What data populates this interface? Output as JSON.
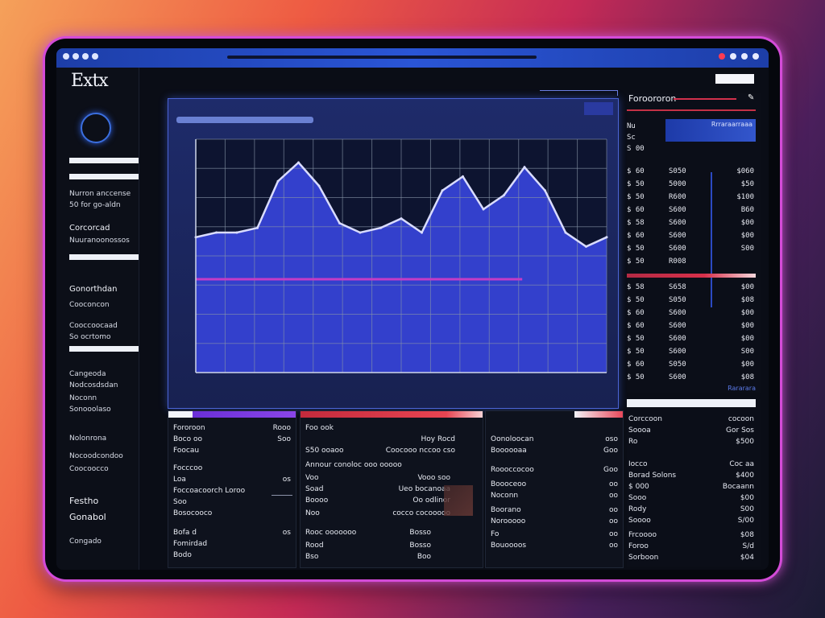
{
  "app": {
    "logo_text": "Extx"
  },
  "sidebar": {
    "items": [
      {
        "label": "Nurron anccense"
      },
      {
        "label": "50 for go-aldn"
      },
      {
        "label": "Corcorcad"
      },
      {
        "label": "Nuuranoonossos"
      },
      {
        "label": "Gonorthdan"
      },
      {
        "label": "Cooconcon"
      },
      {
        "label": "Cooccoocaad"
      },
      {
        "label": "So ocrtomo"
      },
      {
        "label": "Cangeoda"
      },
      {
        "label": "Nodcosdsdan"
      },
      {
        "label": "Noconn"
      },
      {
        "label": "Sonooolaso"
      },
      {
        "label": "Nolonrona"
      },
      {
        "label": "Nocoodcondoo"
      },
      {
        "label": "Coocoocco"
      },
      {
        "label": "Festho"
      },
      {
        "label": "Gonabol"
      },
      {
        "label": "Congado"
      }
    ]
  },
  "chart_data": {
    "type": "area",
    "title": "",
    "xlabel": "",
    "ylabel": "",
    "grid": true,
    "x": [
      0,
      1,
      2,
      3,
      4,
      5,
      6,
      7,
      8,
      9,
      10,
      11,
      12,
      13,
      14,
      15,
      16,
      17,
      18,
      19,
      20
    ],
    "series": [
      {
        "values": [
          58,
          60,
          60,
          62,
          82,
          90,
          80,
          64,
          60,
          62,
          66,
          60,
          78,
          84,
          70,
          76,
          88,
          78,
          60,
          54,
          58
        ]
      }
    ],
    "ylim": [
      0,
      100
    ],
    "colors": {
      "line": "#d9dcff",
      "fill": "#3b48e8",
      "reference_line": "#c43cc6",
      "grid": "#8895a8"
    }
  },
  "side_table": {
    "title": "Foroororon",
    "icon": "pin-icon",
    "band_label": "Rrraraarraaa",
    "rows_top": [
      {
        "c1": "Nu",
        "c2": "",
        "c3": ""
      },
      {
        "c1": "Sc",
        "c2": "",
        "c3": ""
      },
      {
        "c1": "S 00",
        "c2": "",
        "c3": ""
      }
    ],
    "rows_mid": [
      {
        "c1": "$ 60",
        "c2": "S050",
        "c3": "$060"
      },
      {
        "c1": "$ 50",
        "c2": "5000",
        "c3": "$50"
      },
      {
        "c1": "$ 50",
        "c2": "R600",
        "c3": "$100"
      },
      {
        "c1": "$ 60",
        "c2": "S600",
        "c3": "B60"
      },
      {
        "c1": "$ 58",
        "c2": "S600",
        "c3": "$00"
      },
      {
        "c1": "$ 60",
        "c2": "S600",
        "c3": "$00"
      },
      {
        "c1": "$ 50",
        "c2": "S600",
        "c3": "S00"
      },
      {
        "c1": "$ 50",
        "c2": "R008",
        "c3": ""
      }
    ],
    "rows_bottom": [
      {
        "c1": "$ 58",
        "c2": "S658",
        "c3": "$00"
      },
      {
        "c1": "$ 50",
        "c2": "S050",
        "c3": "$08"
      },
      {
        "c1": "$ 60",
        "c2": "S600",
        "c3": "$00"
      },
      {
        "c1": "$ 60",
        "c2": "S600",
        "c3": "$00"
      },
      {
        "c1": "$ 50",
        "c2": "S600",
        "c3": "$00"
      },
      {
        "c1": "$ 50",
        "c2": "S600",
        "c3": "S00"
      },
      {
        "c1": "$ 60",
        "c2": "S050",
        "c3": "$00"
      },
      {
        "c1": "$ 50",
        "c2": "S600",
        "c3": "$08"
      }
    ],
    "footer_label": "Rararara"
  },
  "summary": {
    "rows": [
      {
        "l": "Corccoon",
        "r": "cocoon"
      },
      {
        "l": "Soooa",
        "r": "Gor Sos"
      },
      {
        "l": "Ro",
        "r": "$500"
      },
      {
        "l": "",
        "r": ""
      },
      {
        "l": "Iocco",
        "r": "Coc aa"
      },
      {
        "l": "Borad Solons",
        "r": "$400"
      },
      {
        "l": "$ 000",
        "r": "Bocaann"
      },
      {
        "l": "Sooo",
        "r": "$00"
      },
      {
        "l": "Rody",
        "r": "S00"
      },
      {
        "l": "Soooo",
        "r": "S/00"
      },
      {
        "l": "Frcoooo",
        "r": "$08"
      },
      {
        "l": "Foroo",
        "r": "S/d"
      },
      {
        "l": "Sorboon",
        "r": "$04"
      }
    ]
  },
  "bottom_panels": [
    {
      "rows": [
        {
          "l": "Fororoon",
          "r": "Rooo"
        },
        {
          "l": "Boco oo",
          "r": "Soo"
        },
        {
          "l": "Foocau",
          "r": ""
        },
        {
          "l": "Focccoo",
          "r": ""
        },
        {
          "l": "Loa",
          "r": "os"
        },
        {
          "l": "Foccoacoorch Loroo",
          "r": ""
        },
        {
          "l": "Soo",
          "r": ""
        },
        {
          "l": "Bosocooco",
          "r": ""
        },
        {
          "l": "Bofa d",
          "r": "os"
        },
        {
          "l": "Fomirdad",
          "r": ""
        },
        {
          "l": "Bodo",
          "r": ""
        }
      ]
    },
    {
      "rows": [
        {
          "l": "Foo ook",
          "r": "Hoy Rocd"
        },
        {
          "l": "S50 ooaoo",
          "r": "Coocooo nccoo cso"
        },
        {
          "l": "Annour conoloc ooo ooooo",
          "r": ""
        },
        {
          "l": "Voo",
          "r": "Vooo soo"
        },
        {
          "l": "Soad",
          "r": "Ueo bocanoaa"
        },
        {
          "l": "Boooo",
          "r": "Oo odlinor"
        },
        {
          "l": "Noo",
          "r": "cocco cocooooo"
        },
        {
          "l": "Rooc ooooooo",
          "r": "Bosso"
        },
        {
          "l": "Rood",
          "r": "Bosso"
        },
        {
          "l": "Bso",
          "r": "Boo"
        }
      ]
    },
    {
      "rows": [
        {
          "l": "Oonoloocan",
          "r": "oso"
        },
        {
          "l": "Boooooaa",
          "r": "Goo"
        },
        {
          "l": "Roooccocoo",
          "r": "Goo"
        },
        {
          "l": "Boooceoo",
          "r": "oo"
        },
        {
          "l": "Noconn",
          "r": "oo"
        },
        {
          "l": "Boorano",
          "r": "oo"
        },
        {
          "l": "Norooooo",
          "r": "oo"
        },
        {
          "l": "Fo",
          "r": "oo"
        },
        {
          "l": "Bouoooos",
          "r": "oo"
        }
      ]
    }
  ]
}
